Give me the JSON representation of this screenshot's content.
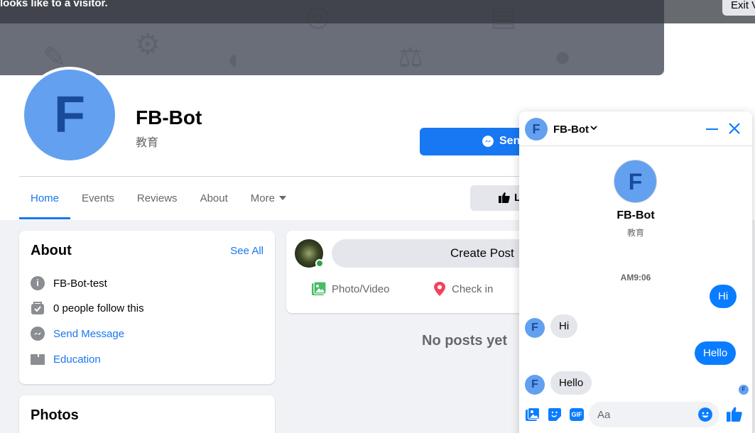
{
  "visitor_bar": {
    "text": "looks like to a visitor.",
    "exit_label": "Exit V"
  },
  "page": {
    "avatar_letter": "F",
    "name": "FB-Bot",
    "category": "教育",
    "send_button_label": "Sen",
    "like_button_label": "L"
  },
  "tabs": [
    {
      "label": "Home",
      "active": true
    },
    {
      "label": "Events"
    },
    {
      "label": "Reviews"
    },
    {
      "label": "About"
    },
    {
      "label": "More"
    }
  ],
  "about": {
    "title": "About",
    "see_all": "See All",
    "items": [
      {
        "icon": "info-icon",
        "text": "FB-Bot-test"
      },
      {
        "icon": "follow-icon",
        "text": "0 people follow this"
      },
      {
        "icon": "messenger-icon",
        "text": "Send Message"
      },
      {
        "icon": "briefcase-icon",
        "text": "Education"
      }
    ]
  },
  "photos": {
    "title": "Photos"
  },
  "create_post": {
    "label": "Create Post",
    "photo_video": "Photo/Video",
    "check_in": "Check in"
  },
  "feed": {
    "empty_text": "No posts yet"
  },
  "chat": {
    "name": "FB-Bot",
    "avatar_letter": "F",
    "title_name": "FB-Bot",
    "title_category": "教育",
    "time": "AM9:06",
    "messages": [
      {
        "from": "me",
        "text": "Hi"
      },
      {
        "from": "them",
        "text": "Hi"
      },
      {
        "from": "me",
        "text": "Hello"
      },
      {
        "from": "them",
        "text": "Hello"
      }
    ],
    "input_placeholder": "Aa",
    "gif_label": "GIF",
    "accent": "#0a7cff"
  },
  "colors": {
    "brand": "#1877f2",
    "avatar_bg": "#63a0ef",
    "avatar_letter": "#1a4a9a"
  }
}
